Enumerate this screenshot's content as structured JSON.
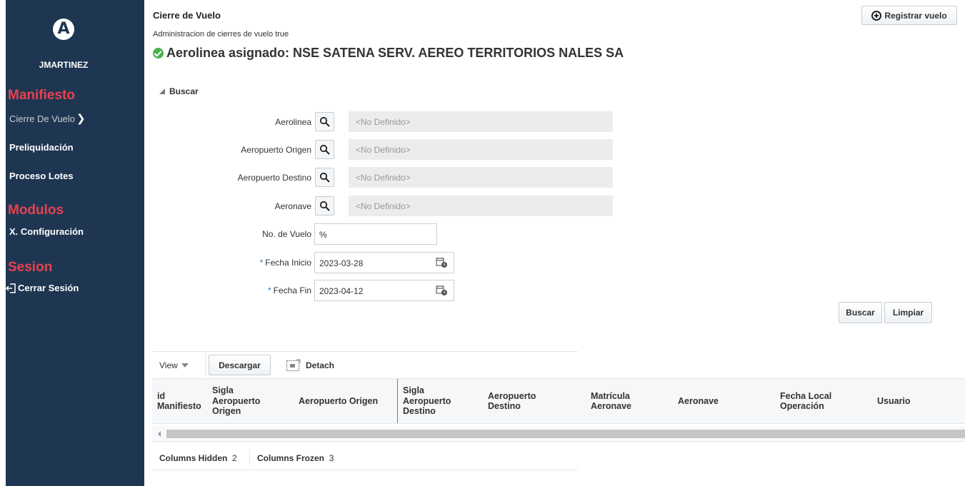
{
  "sidebar": {
    "logo_letter": "A",
    "username": "JMARTINEZ",
    "sections": {
      "manifiesto": "Manifiesto",
      "modulos": "Modulos",
      "sesion": "Sesion"
    },
    "items": {
      "cierre_de_vuelo": "Cierre De Vuelo",
      "preliquidacion": "Preliquidación",
      "proceso_lotes": "Proceso Lotes",
      "configuracion": "X. Configuración",
      "cerrar_sesion": "Cerrar Sesión"
    },
    "colors": {
      "background": "#1f3652",
      "section_title": "#e8414f"
    }
  },
  "header": {
    "title": "Cierre de Vuelo",
    "subtitle": "Administracion de cierres de vuelo true",
    "airline_assigned": "Aerolinea asignado: NSE SATENA SERV. AEREO TERRITORIOS NALES SA",
    "register_button": "Registrar vuelo"
  },
  "search": {
    "toggle_label": "Buscar",
    "fields": {
      "aerolinea": {
        "label": "Aerolinea",
        "value": "<No Definido>"
      },
      "aeropuerto_origen": {
        "label": "Aeropuerto Origen",
        "value": "<No Definido>"
      },
      "aeropuerto_destino": {
        "label": "Aeropuerto Destino",
        "value": "<No Definido>"
      },
      "aeronave": {
        "label": "Aeronave",
        "value": "<No Definido>"
      },
      "no_vuelo": {
        "label": "No. de Vuelo",
        "value": "%"
      },
      "fecha_inicio": {
        "label": "Fecha Inicio",
        "value": "2023-03-28",
        "required_mark": "*"
      },
      "fecha_fin": {
        "label": "Fecha Fin",
        "value": "2023-04-12",
        "required_mark": "*"
      }
    },
    "buttons": {
      "buscar": "Buscar",
      "limpiar": "Limpiar"
    }
  },
  "table": {
    "toolbar": {
      "view": "View",
      "descargar": "Descargar",
      "detach": "Detach"
    },
    "columns": [
      "id Manifiesto",
      "Sigla Aeropuerto Origen",
      "Aeropuerto Origen",
      "Sigla Aeropuerto Destino",
      "Aeropuerto Destino",
      "Matrícula Aeronave",
      "Aeronave",
      "Fecha Local Operación",
      "Usuario"
    ],
    "status": {
      "columns_hidden_label": "Columns Hidden",
      "columns_hidden_value": "2",
      "columns_frozen_label": "Columns Frozen",
      "columns_frozen_value": "3"
    }
  }
}
